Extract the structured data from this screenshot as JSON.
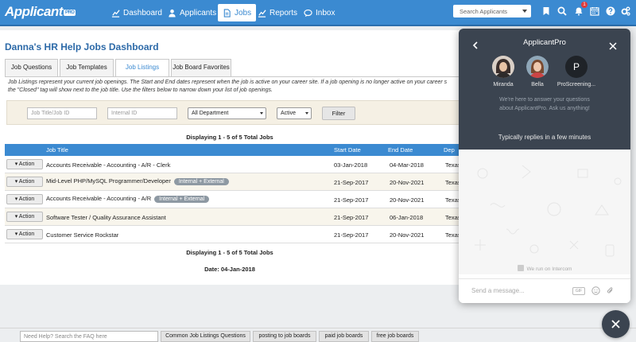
{
  "topbar": {
    "logo": "Applicant",
    "logo_badge": "PRO",
    "nav": [
      {
        "label": "Dashboard",
        "icon": "chart-icon"
      },
      {
        "label": "Applicants",
        "icon": "user-icon"
      },
      {
        "label": "Jobs",
        "icon": "document-icon",
        "active": true
      },
      {
        "label": "Reports",
        "icon": "chart-icon"
      },
      {
        "label": "Inbox",
        "icon": "chat-icon"
      }
    ],
    "search_placeholder": "Search Applicants",
    "notification_count": "1",
    "icons": [
      "bookmark-icon",
      "search-icon",
      "bell-icon",
      "calendar-icon",
      "help-icon",
      "settings-icon"
    ]
  },
  "page": {
    "title": "Danna's HR Help Jobs Dashboard",
    "tabs": [
      "Job Questions",
      "Job Templates",
      "Job Listings",
      "Job Board Favorites"
    ],
    "active_tab": "Job Listings",
    "description_line1": "Job Listings represent your current job openings. The Start and End dates represent when the job is active on your career site. If a job opening is no longer active on your career s",
    "description_line2": "the \"Closed\" tag will show next to the job title. Use the filters below to narrow down your list of job openings."
  },
  "filters": {
    "job_title_placeholder": "Job Title/Job ID",
    "internal_id_placeholder": "Internal ID",
    "department": "All Department",
    "status": "Active",
    "filter_button": "Filter"
  },
  "table": {
    "displaying": "Displaying 1 - 5 of 5 Total Jobs",
    "headers": [
      "Job Title",
      "Start Date",
      "End Date",
      "Dep"
    ],
    "action_label": "Action",
    "rows": [
      {
        "title": "Accounts Receivable - Accounting - A/R - Clerk",
        "tag": "",
        "start": "03-Jan-2018",
        "end": "04-Mar-2018",
        "dept": "Texas"
      },
      {
        "title": "Mid-Level PHP/MySQL Programmer/Developer",
        "tag": "Internal + External",
        "start": "21-Sep-2017",
        "end": "20-Nov-2021",
        "dept": "Texas"
      },
      {
        "title": "Accounts Receivable - Accounting - A/R",
        "tag": "Internal + External",
        "start": "21-Sep-2017",
        "end": "20-Nov-2021",
        "dept": "Texas"
      },
      {
        "title": "Software Tester / Quality Assurance Assistant",
        "tag": "",
        "start": "21-Sep-2017",
        "end": "06-Jan-2018",
        "dept": "Texas"
      },
      {
        "title": "Customer Service Rockstar",
        "tag": "",
        "start": "21-Sep-2017",
        "end": "20-Nov-2021",
        "dept": "Texas"
      }
    ],
    "date_label": "Date: 04-Jan-2018"
  },
  "help_bar": {
    "faq_placeholder": "Need Help? Search the FAQ here",
    "buttons": [
      "Common Job Listings Questions",
      "posting to job boards",
      "paid job boards",
      "free job boards"
    ]
  },
  "chat": {
    "title": "ApplicantPro",
    "agents": [
      {
        "name": "Miranda",
        "initial": ""
      },
      {
        "name": "Bella",
        "initial": ""
      },
      {
        "name": "ProScreening...",
        "initial": "P"
      }
    ],
    "message_line1": "We're here to answer your questions",
    "message_line2": "about ApplicantPro. Ask us anything!",
    "reply_time": "Typically replies in a few minutes",
    "powered_by": "We run on Intercom",
    "input_placeholder": "Send a message...",
    "gif_label": "GIF"
  },
  "colors": {
    "brand_blue": "#3b8ad1",
    "chat_dark": "#3b4450",
    "tag_gray": "#8e99a3",
    "alert_red": "#e03a3a"
  }
}
